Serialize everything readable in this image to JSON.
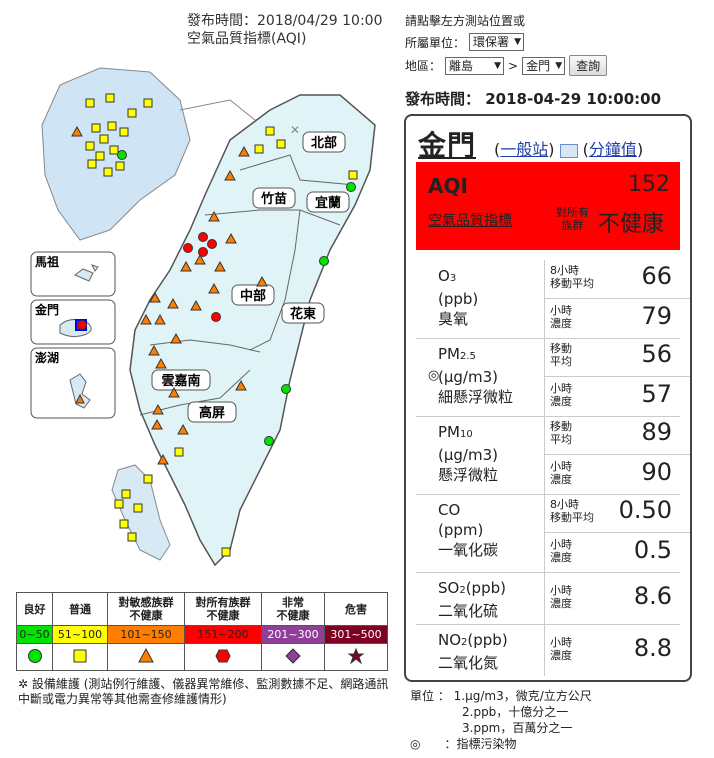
{
  "header": {
    "publish_time_label": "發布時間：2018/04/29 10:00",
    "aqi_title": "空氣品質指標(AQI)"
  },
  "form": {
    "hint": "請點擊左方測站位置或",
    "unit_label": "所屬單位：",
    "unit_value": "環保署",
    "area_label": "地區：",
    "region_value": "離島",
    "station_value": "金門",
    "query_button": "查詢"
  },
  "publish_time_right": "發布時間： 2018-04-29 10:00:00",
  "map": {
    "regions": [
      "北部",
      "竹苗",
      "宜蘭",
      "中部",
      "花東",
      "雲嘉南",
      "高屏"
    ],
    "insets": [
      "馬祖",
      "金門",
      "澎湖"
    ]
  },
  "legend": {
    "headers": [
      "良好",
      "普通",
      "對敏感族群\n不健康",
      "對所有族群\n不健康",
      "非常\n不健康",
      "危害"
    ],
    "ranges": [
      "0~50",
      "51~100",
      "101~150",
      "151~200",
      "201~300",
      "301~500"
    ],
    "range_colors": [
      "#00e400",
      "#ffff00",
      "#ff7e00",
      "#ff0000",
      "#8f3f97",
      "#7e0023"
    ],
    "range_text_colors": [
      "#000",
      "#000",
      "#000",
      "#000",
      "#fff",
      "#fff"
    ],
    "icons": [
      "circle-green",
      "square-yellow",
      "triangle-orange",
      "hexagon-red",
      "diamond-purple",
      "star-brown"
    ],
    "maintenance_note": "設備維護 (測站例行維護、儀器異常維修、監測數據不足、網路通訊中斷或電力異常等其他需查修維護情形)"
  },
  "station": {
    "name": "金門",
    "link_general": "一般站",
    "link_minute": "分鐘值",
    "aqi_label": "AQI",
    "aqi_value": "152",
    "aqi_subtitle": "空氣品質指標",
    "status_small": "對所有\n族群",
    "status": "不健康",
    "pollutants": [
      {
        "name": "O",
        "sub": "3",
        "unit": "(ppb)",
        "cname": "臭氧",
        "avg1": "8小時\n移動平均",
        "val1": "66",
        "avg2": "小時\n濃度",
        "val2": "79"
      },
      {
        "name": "PM",
        "sub": "2.5",
        "unit": "(μg/m3)",
        "cname": "細懸浮微粒",
        "avg1": "移動\n平均",
        "val1": "56",
        "avg2": "小時\n濃度",
        "val2": "57",
        "marked": true
      },
      {
        "name": "PM",
        "sub": "10",
        "unit": "(μg/m3)",
        "cname": "懸浮微粒",
        "avg1": "移動\n平均",
        "val1": "89",
        "avg2": "小時\n濃度",
        "val2": "90"
      },
      {
        "name": "CO",
        "sub": "",
        "unit": "(ppm)",
        "cname": "一氧化碳",
        "avg1": "8小時\n移動平均",
        "val1": "0.50",
        "avg2": "小時\n濃度",
        "val2": "0.5"
      },
      {
        "name": "SO",
        "sub": "2",
        "unit": "(ppb)",
        "cname": "二氧化硫",
        "avg1": "小時\n濃度",
        "val1": "8.6"
      },
      {
        "name": "NO",
        "sub": "2",
        "unit": "(ppb)",
        "cname": "二氧化氮",
        "avg1": "小時\n濃度",
        "val1": "8.8"
      }
    ]
  },
  "units": {
    "label": "單位",
    "line1": "1.μg/m3，微克/立方公尺",
    "line2": "2.ppb，十億分之一",
    "line3": "3.ppm，百萬分之一",
    "marker_note": "指標污染物"
  }
}
